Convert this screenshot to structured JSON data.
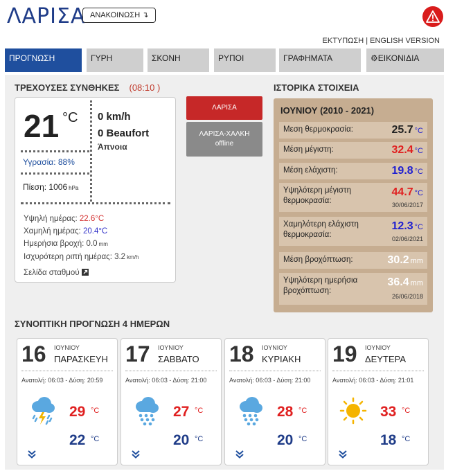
{
  "header": {
    "city": "ΛΑΡΙΣΑ",
    "announce_label": "ΑΝΑΚΟΙΝΩΣΗ ↴",
    "print_label": "ΕΚΤΥΠΩΣΗ",
    "english_label": "ENGLISH VERSION",
    "link_separator": "|"
  },
  "tabs": [
    {
      "label": "ΠΡΟΓΝΩΣΗ",
      "active": true
    },
    {
      "label": "ΓΥΡΗ",
      "active": false
    },
    {
      "label": "ΣΚΟΝΗ",
      "active": false
    },
    {
      "label": "ΡΥΠΟΙ",
      "active": false
    },
    {
      "label": "ΓΡΑΦΗΜΑΤΑ",
      "active": false
    },
    {
      "label": "⚙ΕΙΚΟΝΙΔΙΑ",
      "active": false
    }
  ],
  "current": {
    "title": "ΤΡΕΧΟΥΣΕΣ ΣΥΝΘΗΚΕΣ",
    "time": "(08:10 )",
    "temperature": "21",
    "temp_unit": "°C",
    "wind_kmh": "0 km/h",
    "wind_beaufort": "0 Beaufort",
    "wind_desc": "Άπνοια",
    "humidity": "Υγρασία: 88%",
    "pressure_label": "Πίεση: 1006",
    "pressure_unit": "hPa",
    "day_high_label": "Υψηλή ημέρας: ",
    "day_high": "22.6°C",
    "day_low_label": "Χαμηλή ημέρας: ",
    "day_low": "20.4°C",
    "rain_label": "Ημερήσια βροχή: 0.0",
    "rain_unit": "mm",
    "gust_label": "Ισχυρότερη ριπή ημέρας: 3.2",
    "gust_unit": "km/h",
    "station_link": "Σελίδα σταθμού"
  },
  "stations": {
    "primary": "ΛΑΡΙΣΑ",
    "secondary_name": "ΛΑΡΙΣΑ-ΧΑΛΚΗ",
    "secondary_status": "offline"
  },
  "history": {
    "title": "ΙΣΤΟΡΙΚΑ ΣΤΟΙΧΕΙΑ",
    "period": "ΙΟΥΝΙΟΥ (2010 - 2021)",
    "rows": [
      {
        "label": "Μεση θερμοκρασία:",
        "value": "25.7",
        "unit": "°C",
        "date": "",
        "color": "black"
      },
      {
        "label": "Μέση μέγιστη:",
        "value": "32.4",
        "unit": "°C",
        "date": "",
        "color": "red"
      },
      {
        "label": "Μέση ελάχιστη:",
        "value": "19.8",
        "unit": "°C",
        "date": "",
        "color": "blue"
      },
      {
        "label": "Υψηλότερη μέγιστη θερμοκρασία:",
        "value": "44.7",
        "unit": "°C",
        "date": "30/06/2017",
        "color": "red"
      },
      {
        "label": "Χαμηλότερη ελάχιστη θερμοκρασία:",
        "value": "12.3",
        "unit": "°C",
        "date": "02/06/2021",
        "color": "blue"
      },
      {
        "label": "Μέση βροχόπτωση:",
        "value": "30.2",
        "unit": "mm",
        "date": "",
        "color": "white"
      },
      {
        "label": "Υψηλότερη ημερήσια βροχόπτωση:",
        "value": "36.4",
        "unit": "mm",
        "date": "26/06/2018",
        "color": "white"
      }
    ]
  },
  "forecast": {
    "title": "ΣΥΝΟΠΤΙΚΗ ΠΡΟΓΝΩΣΗ 4 ΗΜΕΡΩΝ",
    "days": [
      {
        "day": "16",
        "month": "ΙΟΥΝΙΟΥ",
        "name": "ΠΑΡΑΣΚΕΥΗ",
        "sun": "Ανατολή: 06:03 - Δύση: 20:59",
        "icon": "thunderstorm-icon",
        "high": "29",
        "low": "22",
        "unit": "°C"
      },
      {
        "day": "17",
        "month": "ΙΟΥΝΙΟΥ",
        "name": "ΣΑΒΒΑΤΟ",
        "sun": "Ανατολή: 06:03 - Δύση: 21:00",
        "icon": "rain-icon",
        "high": "27",
        "low": "20",
        "unit": "°C"
      },
      {
        "day": "18",
        "month": "ΙΟΥΝΙΟΥ",
        "name": "ΚΥΡΙΑΚΗ",
        "sun": "Ανατολή: 06:03 - Δύση: 21:00",
        "icon": "rain-icon",
        "high": "28",
        "low": "20",
        "unit": "°C"
      },
      {
        "day": "19",
        "month": "ΙΟΥΝΙΟΥ",
        "name": "ΔΕΥΤΕΡΑ",
        "sun": "Ανατολή: 06:03 - Δύση: 21:01",
        "icon": "sun-icon",
        "high": "33",
        "low": "18",
        "unit": "°C"
      }
    ]
  },
  "colors": {
    "brand_blue": "#1f4f9e",
    "alert_red": "#d91c1c",
    "history_bg": "#c6ad91"
  }
}
